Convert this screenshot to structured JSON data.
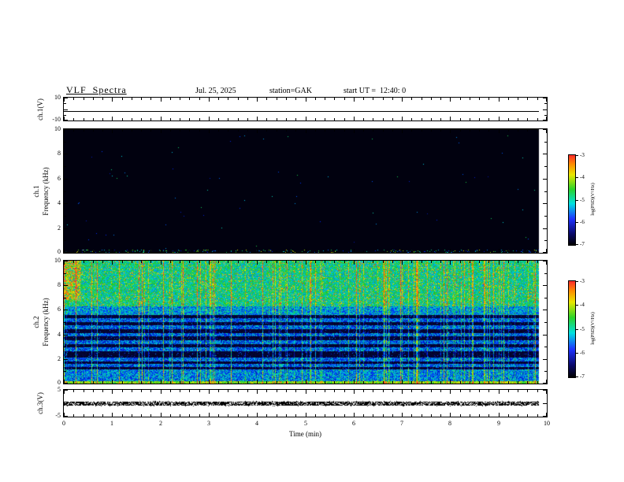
{
  "header": {
    "title": "VLF  Spectra",
    "date": "Jul. 25, 2025",
    "station": "station=GAK",
    "start_ut": "start UT =  12:40: 0"
  },
  "axes": {
    "x": {
      "label": "Time (min)",
      "min": 0,
      "max": 10,
      "major_ticks": [
        0,
        1,
        2,
        3,
        4,
        5,
        6,
        7,
        8,
        9,
        10
      ],
      "minor_step": 0.2,
      "data_end": 9.83
    },
    "panels": [
      {
        "id": "ch1v",
        "left_labels": [
          "ch.1(V)"
        ],
        "ymin": -10,
        "ymax": 10,
        "major_ticks": [
          -10,
          0,
          10
        ],
        "minor_ticks": [
          -5,
          5
        ],
        "labeled_ticks": [
          10,
          -10
        ]
      },
      {
        "id": "ch1spec",
        "left_labels": [
          "ch.1",
          "Frequency (kHz)"
        ],
        "ymin": 0,
        "ymax": 10,
        "major_ticks": [
          0,
          2,
          4,
          6,
          8,
          10
        ],
        "minor_ticks": [
          1,
          3,
          5,
          7,
          9
        ],
        "labeled_ticks": [
          10,
          8,
          6,
          4,
          2,
          0
        ]
      },
      {
        "id": "ch2spec",
        "left_labels": [
          "ch.2",
          "Frequency (kHz)"
        ],
        "ymin": 0,
        "ymax": 10,
        "major_ticks": [
          0,
          2,
          4,
          6,
          8,
          10
        ],
        "minor_ticks": [
          1,
          3,
          5,
          7,
          9
        ],
        "labeled_ticks": [
          10,
          8,
          6,
          4,
          2,
          0
        ]
      },
      {
        "id": "ch3v",
        "left_labels": [
          "ch.3(V)"
        ],
        "ymin": -5,
        "ymax": 5,
        "major_ticks": [
          -5,
          0,
          5
        ],
        "minor_ticks": [],
        "labeled_ticks": [
          5,
          -5
        ]
      }
    ]
  },
  "colorbar": {
    "label": "log(PSD)(V²/Hz)",
    "ticks": [
      -3,
      -4,
      -5,
      -6,
      -7
    ],
    "scale_colors_top_to_bottom": [
      "#ff2a2a",
      "#ff8c00",
      "#e8e800",
      "#2ad42a",
      "#00e0e0",
      "#1e32ff",
      "#0a0a6e",
      "#000000"
    ]
  },
  "chart_data": [
    {
      "type": "line",
      "title": "ch.1(V) waveform",
      "xlabel": "Time (min)",
      "ylabel": "ch.1(V)",
      "xlim": [
        0,
        10
      ],
      "ylim": [
        -10,
        10
      ],
      "x_data_extent": [
        0,
        9.83
      ],
      "series": [
        {
          "name": "ch.1",
          "description": "flat constant trace across the whole record",
          "approx_value": -2
        }
      ]
    },
    {
      "type": "heatmap",
      "title": "ch.1 spectrogram",
      "xlabel": "Time (min)",
      "ylabel": "Frequency (kHz)",
      "xlim": [
        0,
        10
      ],
      "ylim": [
        0,
        10
      ],
      "zlabel": "log(PSD)(V²/Hz)",
      "zlim": [
        -7,
        -3
      ],
      "x_data_extent": [
        0,
        9.83
      ],
      "description": "entire panel at noise floor (~ -7, rendered black) with only sparse colored speckles below ~0.3 kHz"
    },
    {
      "type": "heatmap",
      "title": "ch.2 spectrogram",
      "xlabel": "Time (min)",
      "ylabel": "Frequency (kHz)",
      "xlim": [
        0,
        10
      ],
      "ylim": [
        0,
        10
      ],
      "zlabel": "log(PSD)(V²/Hz)",
      "zlim": [
        -7,
        -3
      ],
      "x_data_extent": [
        0,
        9.83
      ],
      "description": "broadband green/yellow noise above ~6.3 kHz with red-orange enhancement near 0-0.5 min; blue/cyan band 5.6-6.3 kHz; horizontal blue band structure near 5.2, 4.6, 4.0, 3.4, 2.8, 2.0 and 1.5 kHz over a near-black background; enhanced blue/cyan band 0.3-1.2 kHz; bright green line at ~0 kHz; many vertical impulsive green/yellow streaks through all frequencies",
      "band_centers_khz": [
        5.2,
        4.6,
        4.0,
        3.4,
        2.8,
        2.0,
        1.5
      ]
    },
    {
      "type": "line",
      "title": "ch.3(V) waveform",
      "xlabel": "Time (min)",
      "ylabel": "ch.3(V)",
      "xlim": [
        0,
        10
      ],
      "ylim": [
        -5,
        5
      ],
      "x_data_extent": [
        0,
        9.83
      ],
      "series": [
        {
          "name": "ch.3",
          "description": "dense noisy band centered near 0 V, about ±0.8 V thick, stippled appearance"
        }
      ]
    }
  ]
}
